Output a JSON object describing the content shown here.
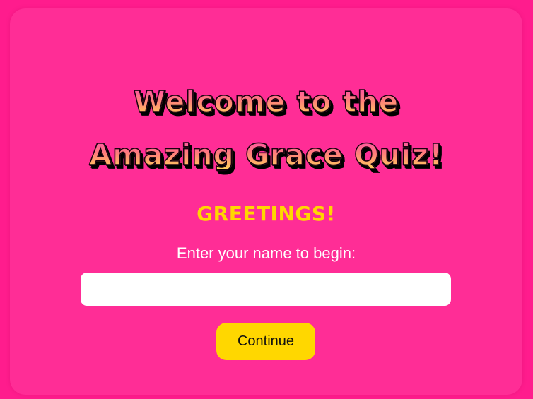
{
  "quiz": {
    "title_line_1": "Welcome to the",
    "title_line_2": "Amazing Grace Quiz!",
    "greeting": "GREETINGS!",
    "prompt": "Enter your name to begin:",
    "name_input_value": "",
    "continue_label": "Continue"
  },
  "colors": {
    "page_background": "#ff1c8d",
    "card_background": "#ff2d96",
    "accent_yellow": "#ffd700",
    "prompt_text": "#ffffff"
  }
}
